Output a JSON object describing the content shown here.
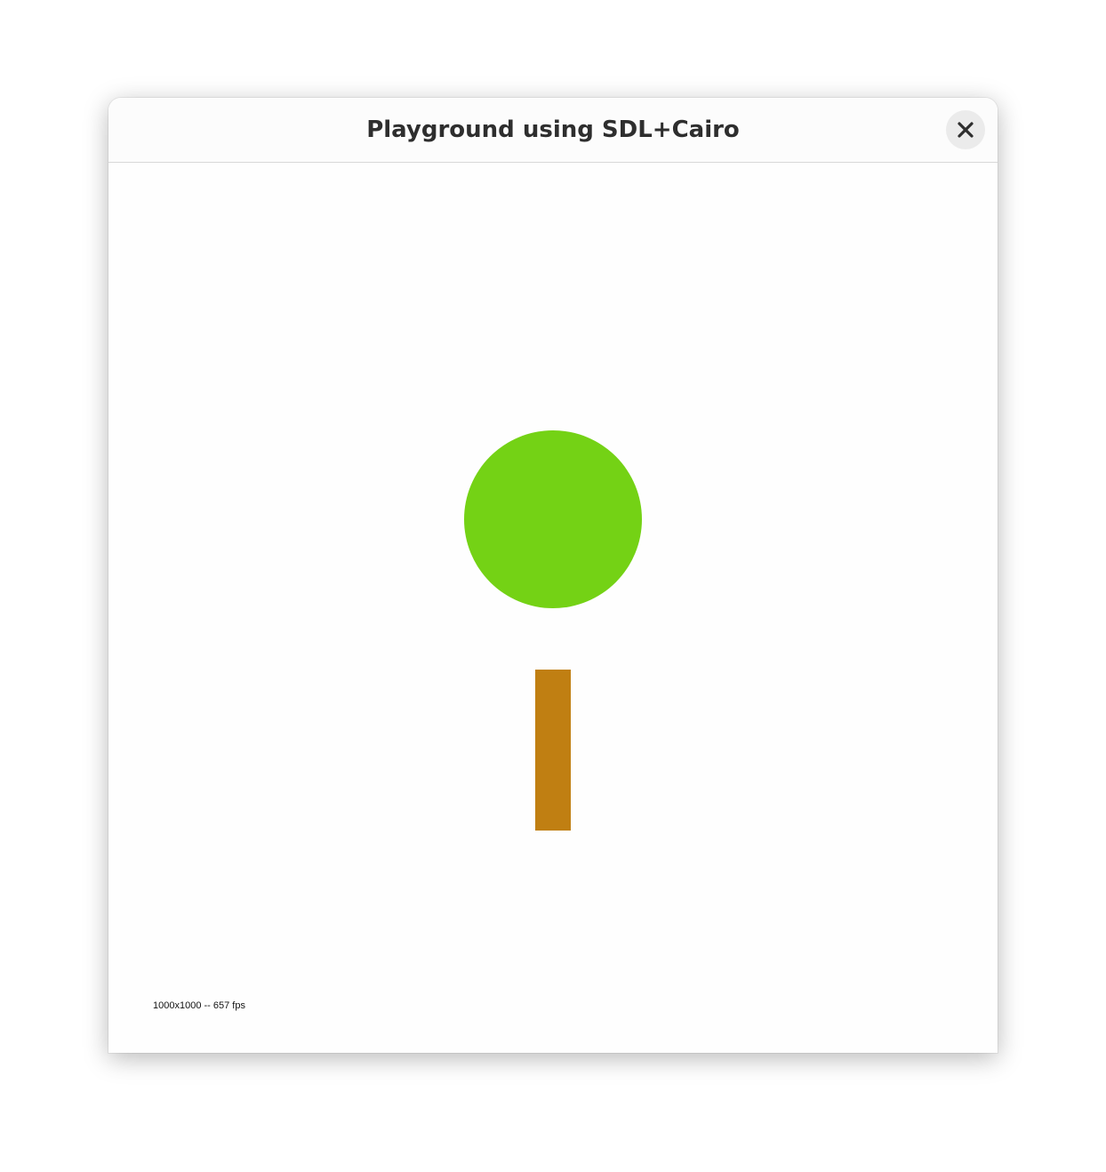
{
  "window": {
    "title": "Playground using SDL+Cairo",
    "close_icon": "close-icon"
  },
  "scene": {
    "crown_color": "#74d215",
    "trunk_color": "#c07f12"
  },
  "status": {
    "text": "1000x1000 -- 657 fps"
  }
}
